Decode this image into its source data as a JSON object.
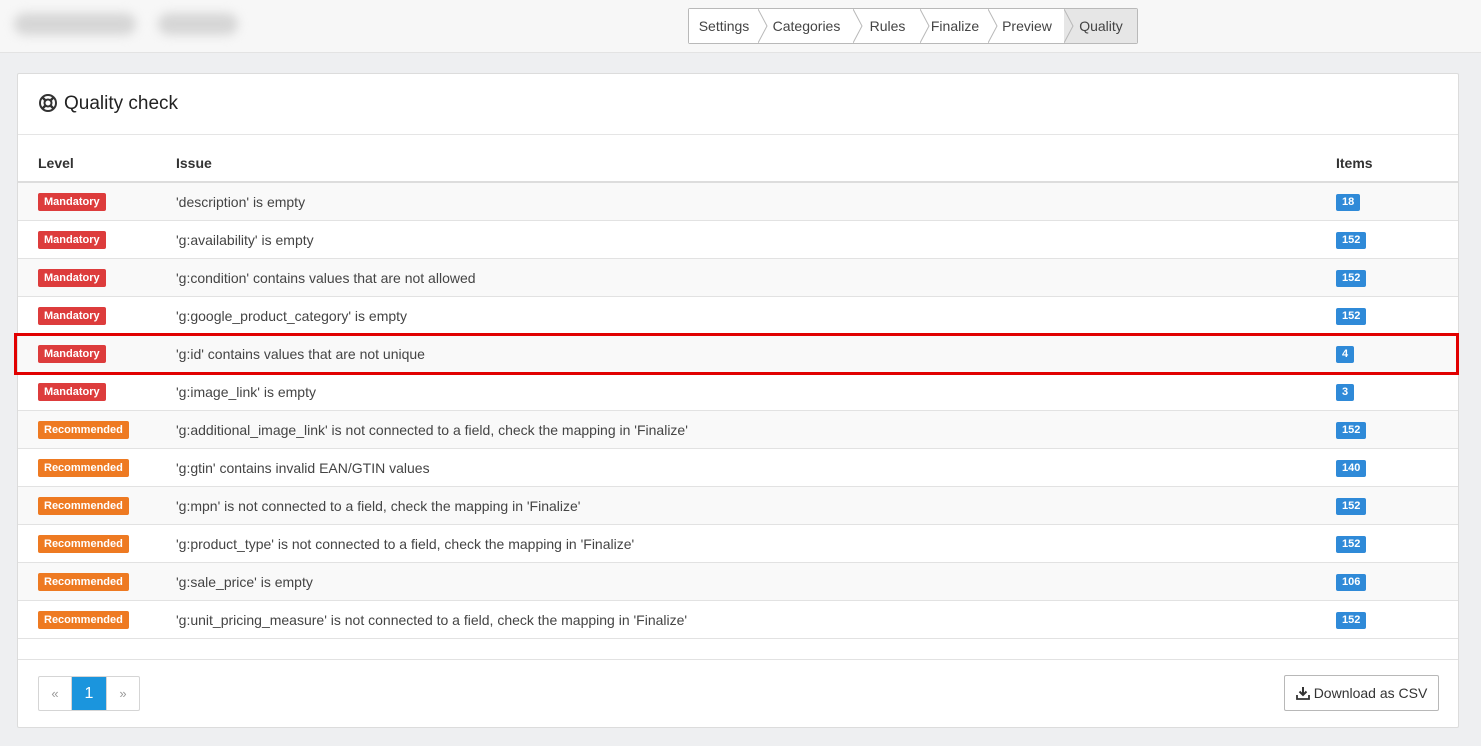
{
  "wizard": {
    "steps": [
      {
        "label": "Settings"
      },
      {
        "label": "Categories"
      },
      {
        "label": "Rules"
      },
      {
        "label": "Finalize"
      },
      {
        "label": "Preview"
      },
      {
        "label": "Quality",
        "active": true
      }
    ]
  },
  "panel": {
    "title": "Quality check",
    "icon": "lifebuoy-icon"
  },
  "table": {
    "columns": {
      "level": "Level",
      "issue": "Issue",
      "items": "Items"
    },
    "rows": [
      {
        "level": "Mandatory",
        "issue": "'description' is empty",
        "items": "18"
      },
      {
        "level": "Mandatory",
        "issue": "'g:availability' is empty",
        "items": "152"
      },
      {
        "level": "Mandatory",
        "issue": "'g:condition' contains values that are not allowed",
        "items": "152"
      },
      {
        "level": "Mandatory",
        "issue": "'g:google_product_category' is empty",
        "items": "152"
      },
      {
        "level": "Mandatory",
        "issue": "'g:id' contains values that are not unique",
        "items": "4"
      },
      {
        "level": "Mandatory",
        "issue": "'g:image_link' is empty",
        "items": "3"
      },
      {
        "level": "Recommended",
        "issue": "'g:additional_image_link' is not connected to a field, check the mapping in 'Finalize'",
        "items": "152"
      },
      {
        "level": "Recommended",
        "issue": "'g:gtin' contains invalid EAN/GTIN values",
        "items": "140"
      },
      {
        "level": "Recommended",
        "issue": "'g:mpn' is not connected to a field, check the mapping in 'Finalize'",
        "items": "152"
      },
      {
        "level": "Recommended",
        "issue": "'g:product_type' is not connected to a field, check the mapping in 'Finalize'",
        "items": "152"
      },
      {
        "level": "Recommended",
        "issue": "'g:sale_price' is empty",
        "items": "106"
      },
      {
        "level": "Recommended",
        "issue": "'g:unit_pricing_measure' is not connected to a field, check the mapping in 'Finalize'",
        "items": "152"
      }
    ]
  },
  "pagination": {
    "prev": "«",
    "current": "1",
    "next": "»"
  },
  "download": {
    "label": "Download as CSV",
    "icon": "download-icon"
  },
  "colors": {
    "mandatory": "#dd3c3c",
    "recommended": "#ee7a22",
    "items_badge": "#2f8ad8",
    "pager_active": "#1b95dd",
    "highlight": "#e10000"
  }
}
